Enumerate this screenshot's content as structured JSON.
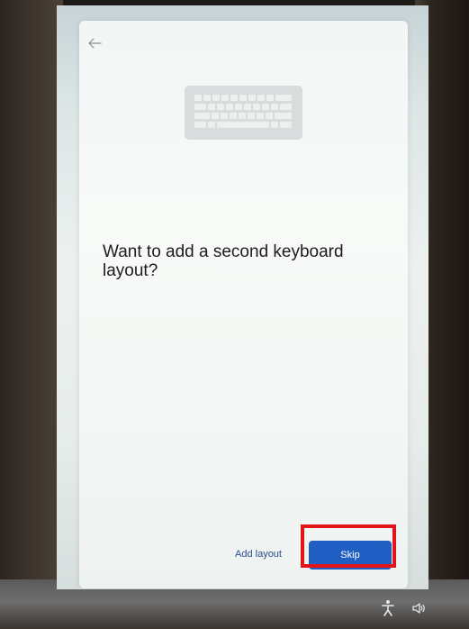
{
  "oobe": {
    "heading": "Want to add a second keyboard layout?",
    "add_layout_label": "Add layout",
    "skip_label": "Skip"
  },
  "icons": {
    "back": "back-arrow-icon",
    "illustration": "keyboard-icon",
    "accessibility": "accessibility-icon",
    "volume": "volume-icon"
  },
  "colors": {
    "accent": "#1f5fc4",
    "link": "#2a4d8a",
    "highlight": "#e3151b"
  }
}
